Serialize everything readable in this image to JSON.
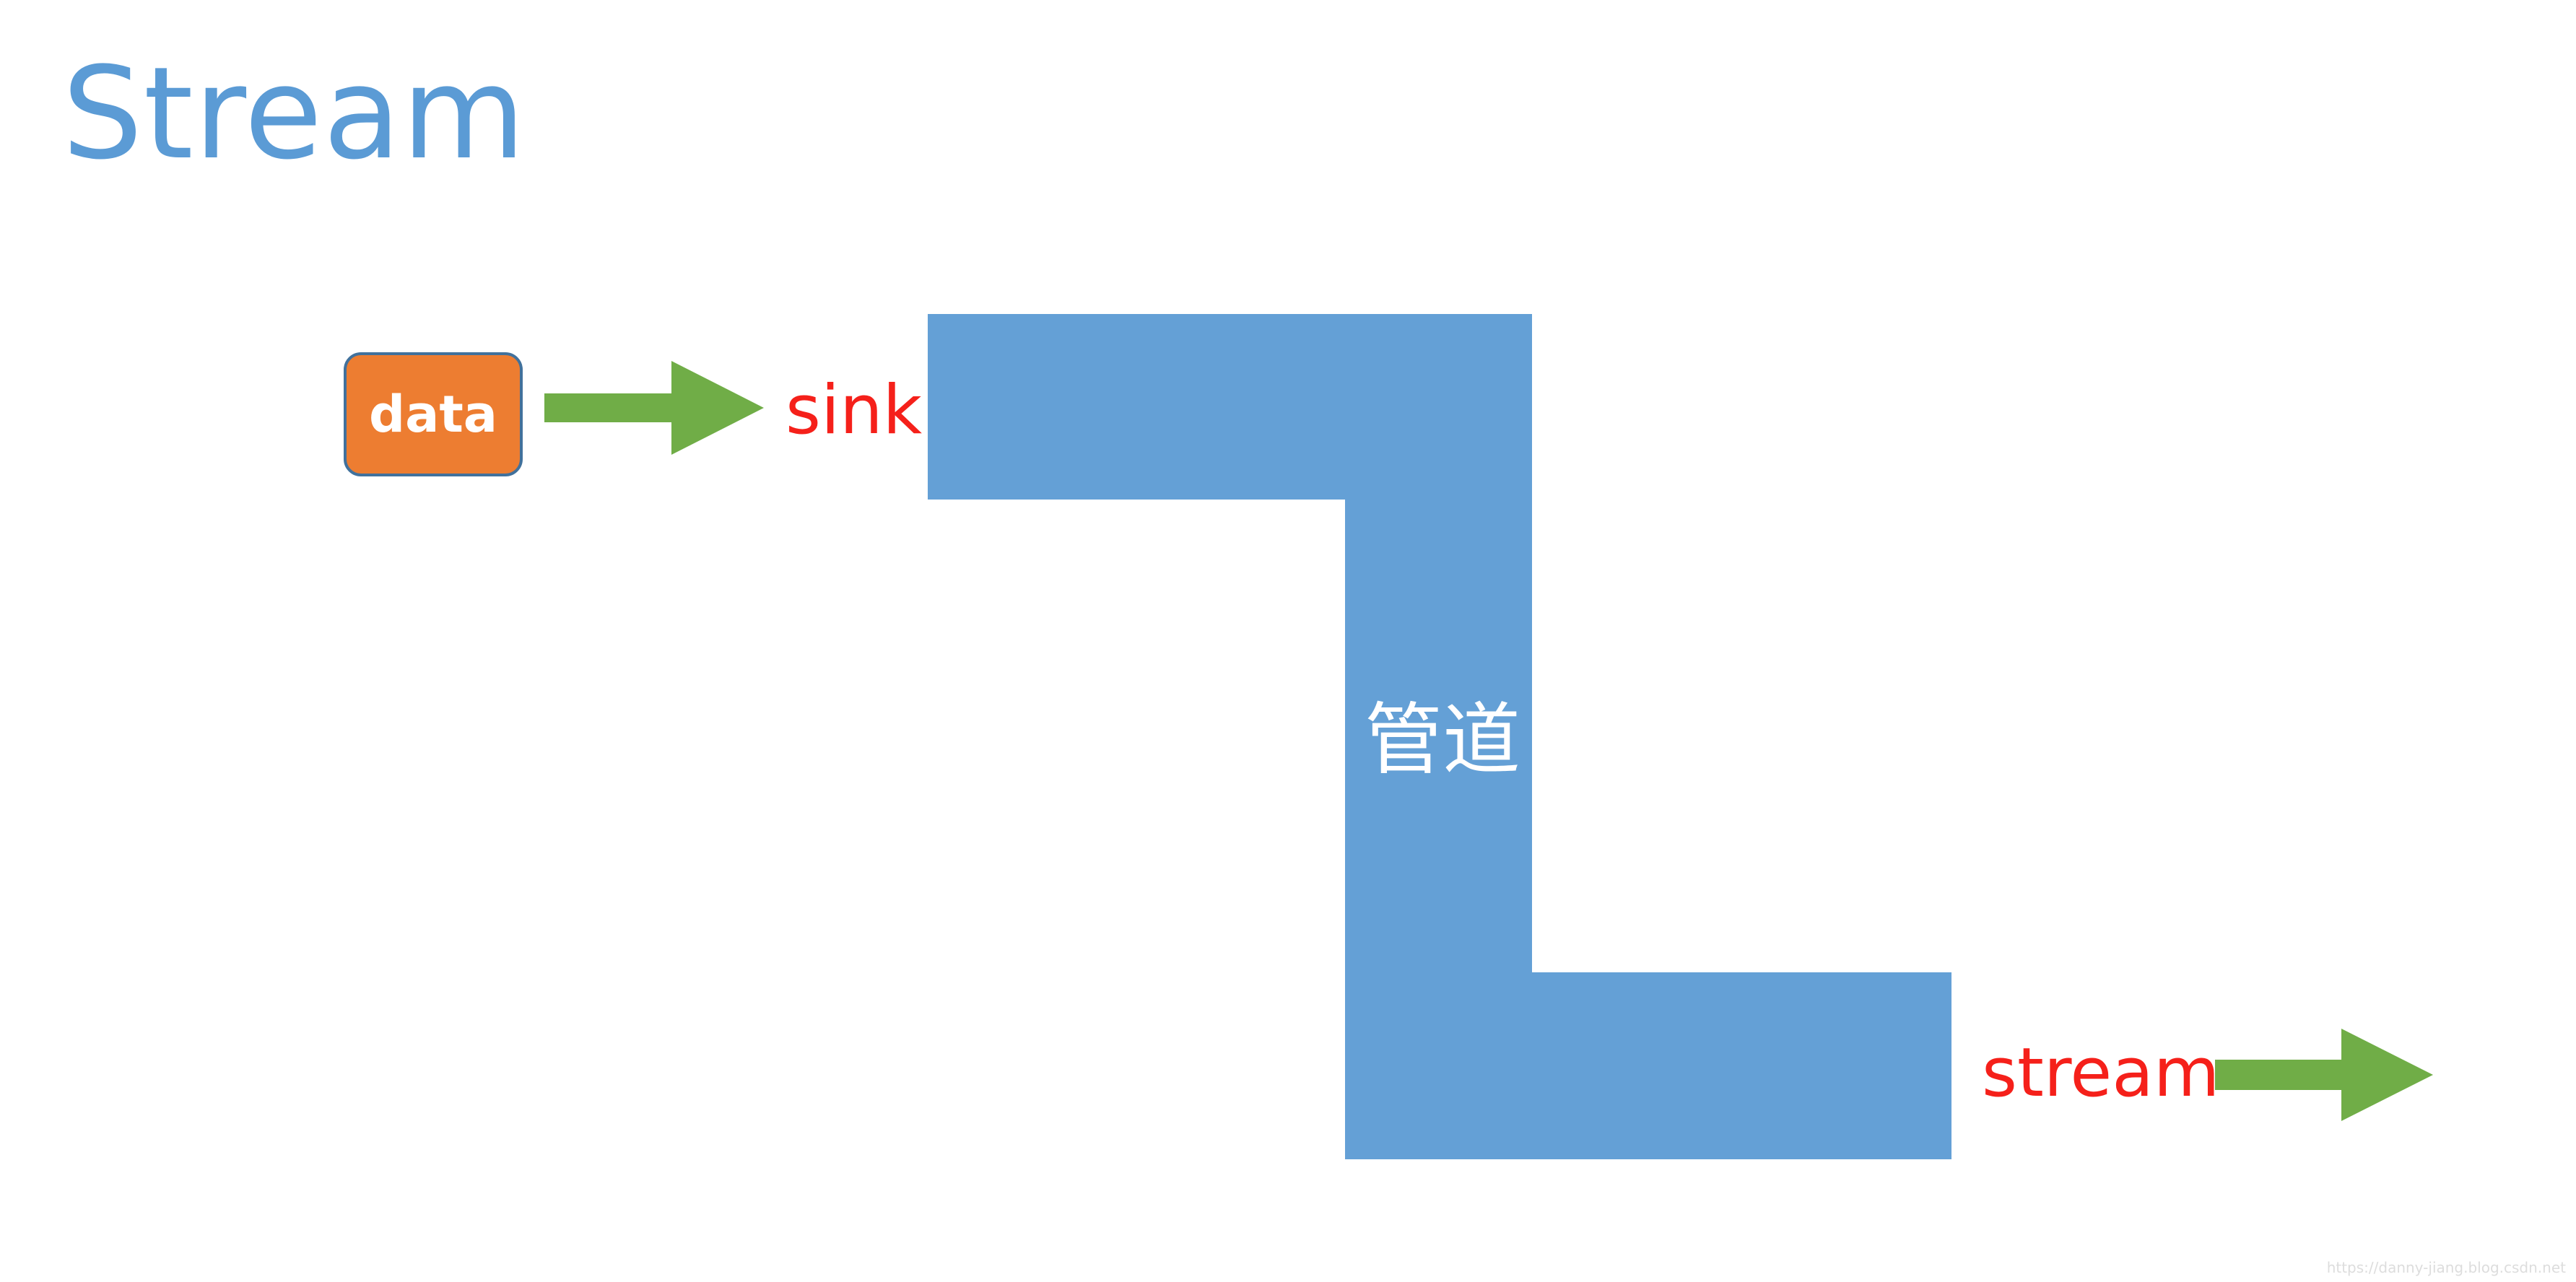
{
  "title": "Stream",
  "nodes": {
    "data_box": "data",
    "sink_label": "sink",
    "pipe_label": "管道",
    "stream_label": "stream"
  },
  "watermark": "https://danny-jiang.blog.csdn.net",
  "colors": {
    "title": "#5b9bd5",
    "pipe": "#64a0d6",
    "data_box_fill": "#ed7d31",
    "data_box_border": "#41719c",
    "arrow": "#70ad47",
    "labels_red": "#f5201a",
    "pipe_text": "#ffffff"
  }
}
